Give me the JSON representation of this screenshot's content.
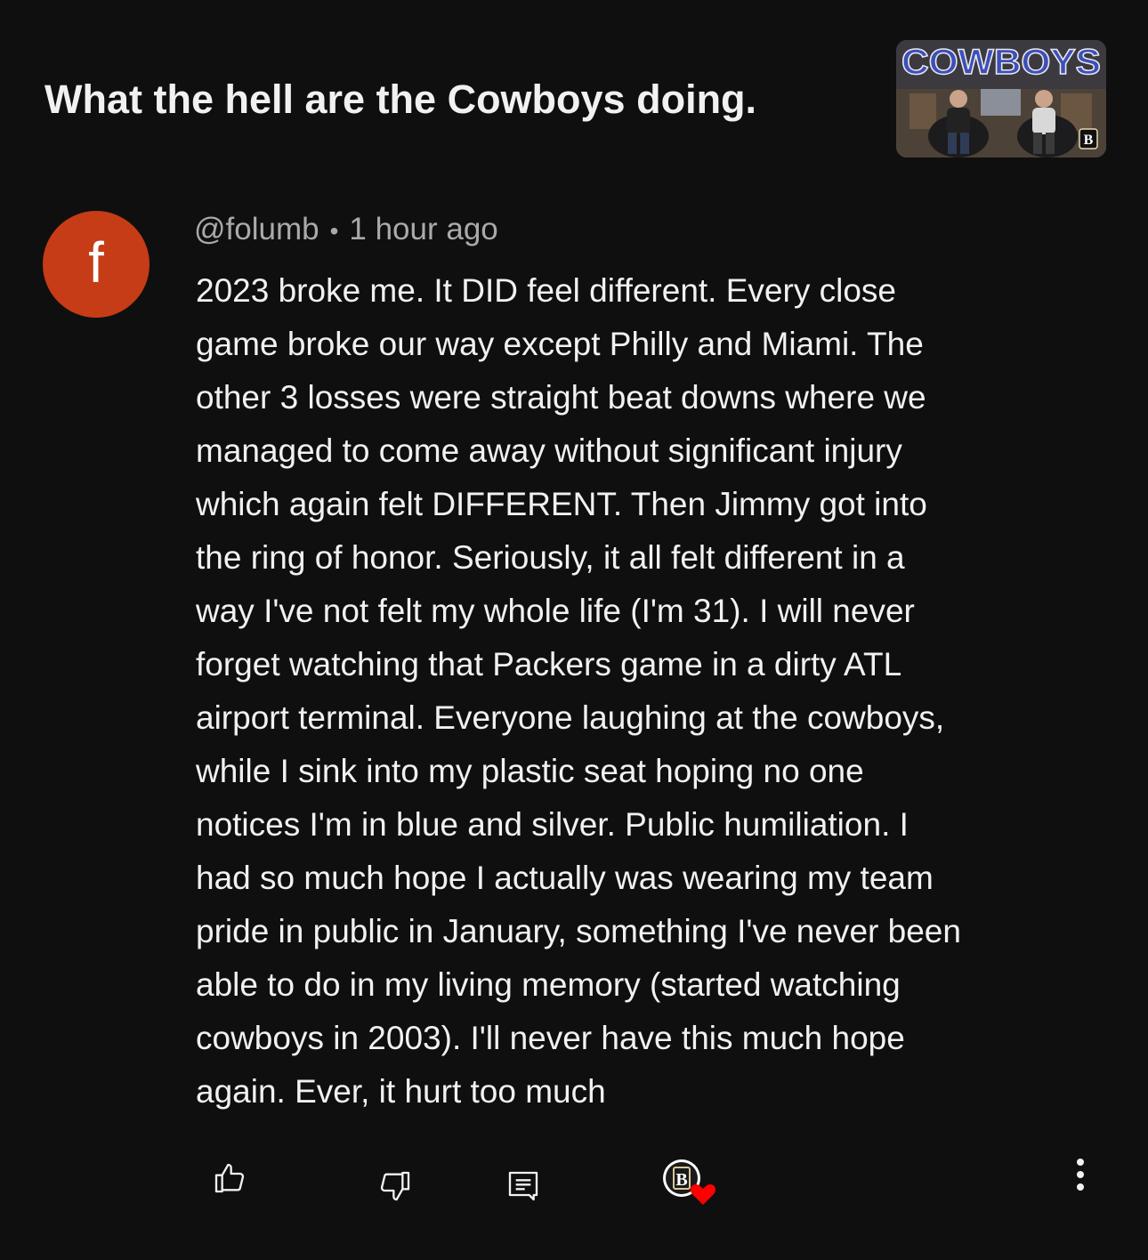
{
  "video": {
    "title": "What the hell are the Cowboys doing.",
    "thumbnail_text": "COWBOYS",
    "thumbnail_badge": "B"
  },
  "comment": {
    "avatar_letter": "f",
    "avatar_color": "#c53c16",
    "author": "@folumb",
    "separator": "•",
    "timestamp": "1 hour ago",
    "lines": [
      "2023 broke me. It DID feel different. Every close",
      "game broke our way except Philly and Miami. The",
      "other 3 losses were straight beat downs where we",
      "managed to come away without significant injury",
      "which again felt DIFFERENT. Then Jimmy got into",
      "the ring of honor. Seriously, it all felt different in a",
      "way I've not felt my whole life (I'm 31). I will never",
      "forget watching that Packers game in a dirty ATL",
      "airport terminal. Everyone laughing at the cowboys,",
      "while I sink into my plastic seat hoping no one",
      "notices I'm in blue and silver. Public humiliation. I",
      "had so much hope I actually was wearing my team",
      "pride in public in January, something I've never been",
      "able to do in my living memory (started watching",
      "cowboys in 2003). I'll never have this much hope",
      "again. Ever, it hurt too much"
    ]
  },
  "actions": {
    "like_icon": "thumbs-up-icon",
    "dislike_icon": "thumbs-down-icon",
    "reply_icon": "comment-icon",
    "creator_heart_icon": "creator-heart-icon",
    "more_icon": "more-vertical-icon",
    "heart_color": "#ff0000"
  }
}
